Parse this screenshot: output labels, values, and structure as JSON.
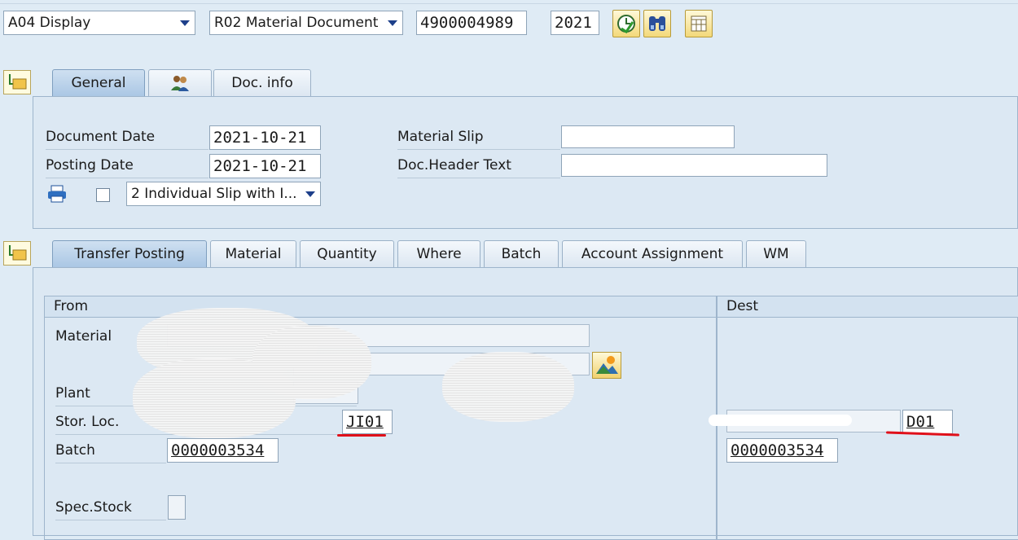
{
  "toolbar": {
    "action_select": "A04 Display",
    "doc_type_select": "R02 Material Document",
    "doc_number": "4900004989",
    "doc_year": "2021"
  },
  "header_tabs": [
    {
      "label": "General"
    },
    {
      "label": ""
    },
    {
      "label": "Doc. info"
    }
  ],
  "general": {
    "document_date_label": "Document Date",
    "document_date": "2021-10-21",
    "posting_date_label": "Posting Date",
    "posting_date": "2021-10-21",
    "material_slip_label": "Material Slip",
    "material_slip": "",
    "header_text_label": "Doc.Header Text",
    "header_text": "",
    "print_version": "2 Individual Slip with I..."
  },
  "item_tabs": [
    {
      "label": "Transfer Posting"
    },
    {
      "label": "Material"
    },
    {
      "label": "Quantity"
    },
    {
      "label": "Where"
    },
    {
      "label": "Batch"
    },
    {
      "label": "Account Assignment"
    },
    {
      "label": "WM"
    }
  ],
  "transfer": {
    "from_header": "From",
    "dest_header": "Dest",
    "material_label": "Material",
    "plant_label": "Plant",
    "stor_loc_label": "Stor. Loc.",
    "batch_label": "Batch",
    "spec_stock_label": "Spec.Stock",
    "from_stor_loc": "JI01",
    "from_batch": "0000003534",
    "dest_stor_loc": "D01",
    "dest_batch": "0000003534"
  },
  "colors": {
    "background": "#dfebf5",
    "active_tab": "#a9c6e4",
    "annotation_underline": "#e0101a"
  },
  "icons": [
    "dropdown-arrow-icon",
    "execute-clock-icon",
    "binoculars-icon",
    "grid-icon",
    "folder-tree-icon",
    "partner-icon",
    "printer-icon",
    "landscape-icon"
  ]
}
